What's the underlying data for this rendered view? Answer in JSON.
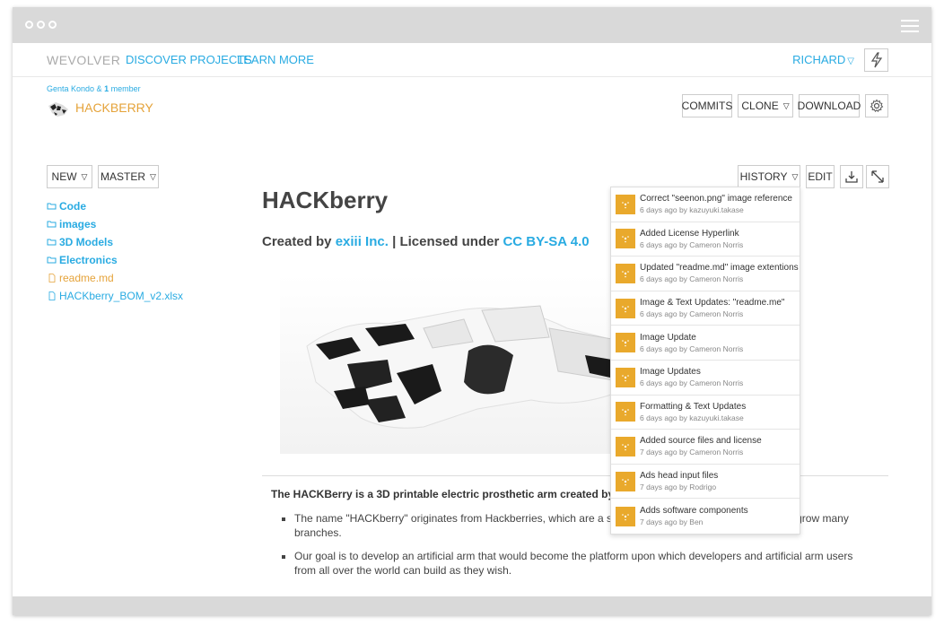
{
  "nav": {
    "brand": "WEVOLVER",
    "links": [
      "DISCOVER PROJECTS",
      "LEARN MORE"
    ],
    "user": "RICHARD"
  },
  "repo": {
    "owner": "Genta Kondo &",
    "member_count": "1",
    "member_word": "member",
    "name": "HACKBERRY"
  },
  "toolbar": {
    "commits": "COMMITS",
    "clone": "CLONE",
    "download": "DOWNLOAD",
    "new": "NEW",
    "branch": "MASTER",
    "history": "HISTORY",
    "edit": "EDIT"
  },
  "sidebar": {
    "items": [
      {
        "label": "Code",
        "type": "folder"
      },
      {
        "label": "images",
        "type": "folder"
      },
      {
        "label": "3D Models",
        "type": "folder"
      },
      {
        "label": "Electronics",
        "type": "folder"
      },
      {
        "label": "readme.md",
        "type": "file"
      },
      {
        "label": "HACKberry_BOM_v2.xlsx",
        "type": "file"
      }
    ]
  },
  "main": {
    "title": "HACKberry",
    "created_prefix": "Created by ",
    "created_by": "exiii Inc.",
    "license_prefix": " | Licensed under ",
    "license": "CC BY-SA 4.0",
    "intro": "The HACKBerry is a 3D printable electric prosthetic arm created by exiii",
    "bullets": [
      "The name \"HACKberry\" originates from Hackberries, which are a sp                                                        y, grow many branches.",
      "Our goal is to develop an artificial arm that would become the platform upon which developers and artificial arm users from all over the world can build as they wish."
    ]
  },
  "history": [
    {
      "message": "Correct \"seenon.png\" image reference",
      "meta": "6 days ago by kazuyuki.takase"
    },
    {
      "message": "Added License Hyperlink",
      "meta": "6 days ago by Cameron Norris"
    },
    {
      "message": "Updated \"readme.md\" image extentions",
      "meta": "6 days ago by Cameron Norris"
    },
    {
      "message": "Image & Text Updates: \"readme.me\"",
      "meta": "6 days ago by Cameron Norris"
    },
    {
      "message": "Image Update",
      "meta": "6 days ago by Cameron Norris"
    },
    {
      "message": "Image Updates",
      "meta": "6 days ago by Cameron Norris"
    },
    {
      "message": "Formatting & Text Updates",
      "meta": "6 days ago by kazuyuki.takase"
    },
    {
      "message": "Added source files and license",
      "meta": "7 days ago by Cameron Norris"
    },
    {
      "message": "Ads head input files",
      "meta": "7 days ago by Rodrigo"
    },
    {
      "message": "Adds software components",
      "meta": "7 days ago by Ben"
    }
  ],
  "colors": {
    "accent": "#29abe2",
    "brand_orange": "#e5a33a",
    "commit_icon": "#e9a92c",
    "chrome": "#d9d9d9"
  },
  "icons": [
    "window-dots-icon",
    "hamburger-icon",
    "bolt-icon",
    "gear-icon",
    "download-icon",
    "expand-icon",
    "folder-icon",
    "file-icon",
    "commit-icon",
    "chevron-down-icon"
  ]
}
